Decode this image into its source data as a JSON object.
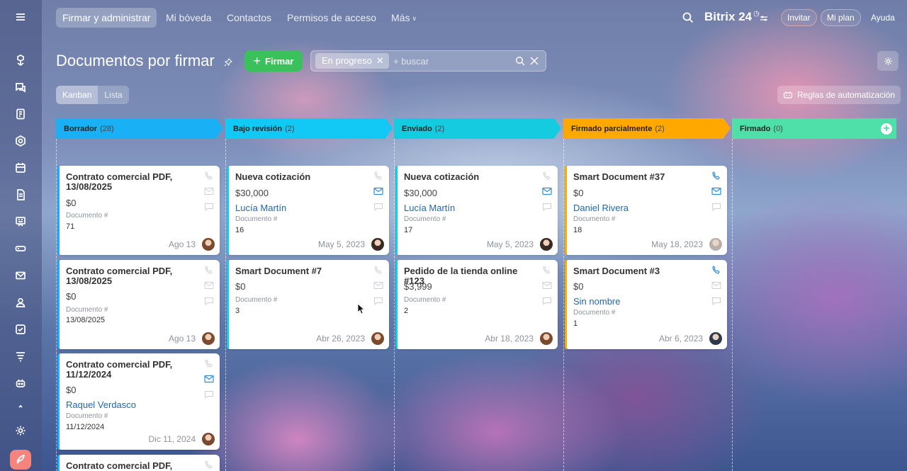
{
  "topbar": {
    "menu": [
      "Firmar y administrar",
      "Mi bóveda",
      "Contactos",
      "Permisos de acceso",
      "Más"
    ],
    "brand": "Bitrix",
    "brand_number": "24",
    "invite": "Invitar",
    "my_plan": "Mi plan",
    "help": "Ayuda"
  },
  "page": {
    "title": "Documentos por firmar",
    "sign_button": "Firmar",
    "filter_chip": "En progreso",
    "search_placeholder": "+ buscar",
    "views": [
      "Kanban",
      "Lista"
    ],
    "automation_rules": "Reglas de automatización"
  },
  "colors": {
    "borrador": "#1ab0f5",
    "bajo_revision": "#12c8f4",
    "enviado": "#14cbe0",
    "firmado_parcialmente": "#ffa900",
    "firmado": "#4fdfa9",
    "sign_button": "#3bc15b",
    "link": "#2067b0"
  },
  "columns": [
    {
      "name": "Borrador",
      "count": "(28)"
    },
    {
      "name": "Bajo revisión",
      "count": "(2)"
    },
    {
      "name": "Enviado",
      "count": "(2)"
    },
    {
      "name": "Firmado parcialmente",
      "count": "(2)"
    },
    {
      "name": "Firmado",
      "count": "(0)"
    }
  ],
  "cards": {
    "c1": {
      "title": "Contrato comercial PDF, 13/08/2025",
      "amount": "$0",
      "doc_label": "Documento #",
      "doc_value": "71",
      "date": "Ago 13"
    },
    "c2": {
      "title": "Contrato comercial PDF, 13/08/2025",
      "amount": "$0",
      "doc_label": "Documento #",
      "doc_value": "13/08/2025",
      "date": "Ago 13"
    },
    "c3": {
      "title": "Contrato comercial PDF, 11/12/2024",
      "amount": "$0",
      "contact": "Raquel Verdasco",
      "doc_label": "Documento #",
      "doc_value": "11/12/2024",
      "date": "Dic 11, 2024"
    },
    "c4": {
      "title": "Contrato comercial PDF,"
    },
    "c5": {
      "title": "Nueva cotización",
      "amount": "$30,000",
      "contact": "Lucía Martín",
      "doc_label": "Documento #",
      "doc_value": "16",
      "date": "May 5, 2023"
    },
    "c6": {
      "title": "Smart Document #7",
      "amount": "$0",
      "doc_label": "Documento #",
      "doc_value": "3",
      "date": "Abr 26, 2023"
    },
    "c7": {
      "title": "Nueva cotización",
      "amount": "$30,000",
      "contact": "Lucía Martín",
      "doc_label": "Documento #",
      "doc_value": "17",
      "date": "May 5, 2023"
    },
    "c8": {
      "title": "Pedido de la tienda online #123",
      "amount": "$3,999",
      "doc_label": "Documento #",
      "doc_value": "2",
      "date": "Abr 18, 2023"
    },
    "c9": {
      "title": "Smart Document #37",
      "amount": "$0",
      "contact": "Daniel Rivera",
      "doc_label": "Documento #",
      "doc_value": "18",
      "date": "May 18, 2023"
    },
    "c10": {
      "title": "Smart Document #3",
      "amount": "$0",
      "contact": "Sin nombre",
      "doc_label": "Documento #",
      "doc_value": "1",
      "date": "Abr 6, 2023"
    }
  }
}
